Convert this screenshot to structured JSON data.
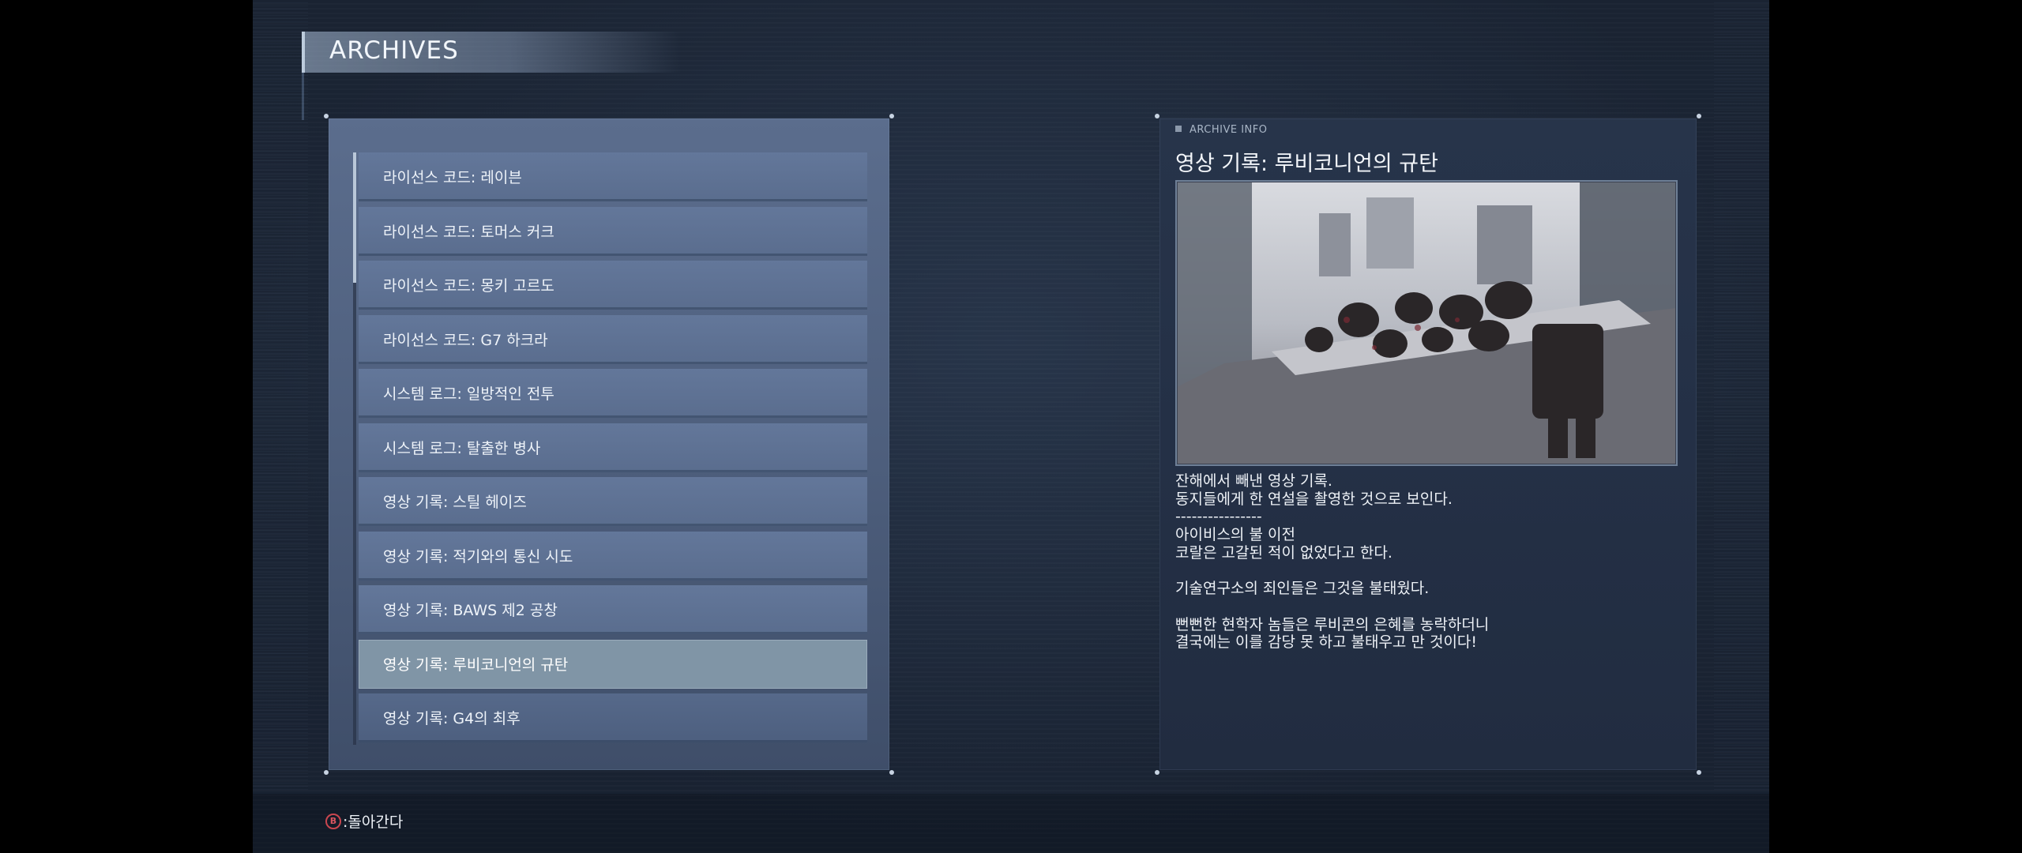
{
  "header": {
    "title": "ARCHIVES"
  },
  "archive_list": {
    "items": [
      {
        "label": "라이선스 코드: 레이븐"
      },
      {
        "label": "라이선스 코드: 토머스 커크"
      },
      {
        "label": "라이선스 코드: 몽키 고르도"
      },
      {
        "label": "라이선스 코드: G7 하크라"
      },
      {
        "label": "시스템 로그: 일방적인 전투"
      },
      {
        "label": "시스템 로그: 탈출한 병사"
      },
      {
        "label": "영상 기록: 스틸 헤이즈"
      },
      {
        "label": "영상 기록: 적기와의 통신 시도"
      },
      {
        "label": "영상 기록: BAWS 제2 공창"
      },
      {
        "label": "영상 기록: 루비코니언의 규탄"
      },
      {
        "label": "영상 기록: G4의 최후"
      }
    ],
    "selected_index": 9
  },
  "archive_info": {
    "section_label": "ARCHIVE INFO",
    "title": "영상 기록: 루비코니언의 규탄",
    "image_alt": "video-still",
    "description": "잔해에서 빼낸 영상 기록.\n동지들에게 한 연설을 촬영한 것으로 보인다.\n----------------\n아이비스의 불 이전\n코랄은 고갈된 적이 없었다고 한다.\n\n기술연구소의 죄인들은 그것을 불태웠다.\n\n뻔뻔한 현학자 놈들은 루비콘의 은혜를 농락하더니\n결국에는 이를 감당 못 하고 불태우고 만 것이다!"
  },
  "footer": {
    "back_button_key": "B",
    "back_label": ":돌아간다"
  },
  "colors": {
    "accent_red": "#c9464f",
    "selected_item": "#8095a6"
  }
}
